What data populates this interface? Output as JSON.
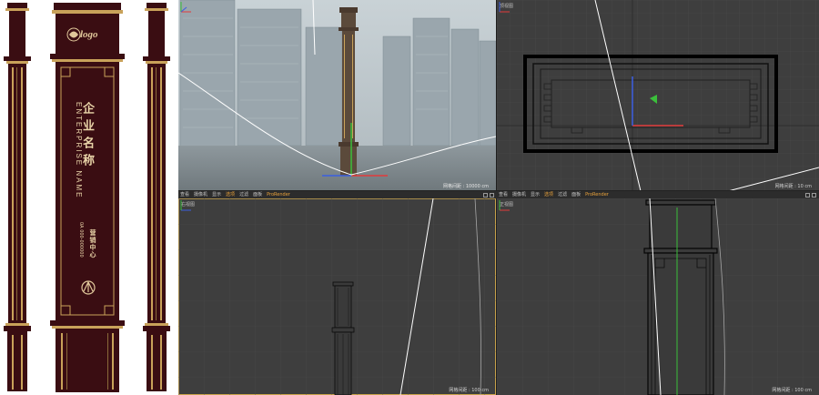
{
  "elevation": {
    "logo_text": "logo",
    "title_cn": "企业名称",
    "title_en": "ENTERPRISE NAME",
    "sales_center": "营销中心",
    "phone": "0A 000-000000"
  },
  "viewports": {
    "perspective": {
      "name": "",
      "grid_info": "网格间距 : 10000 cm"
    },
    "top": {
      "name": "顶视图",
      "grid_info": "网格间距 : 10 cm"
    },
    "right": {
      "name": "右视图",
      "grid_info": "网格间距 : 100 cm"
    },
    "front": {
      "name": "正视图",
      "grid_info": "网格间距 : 100 cm"
    }
  },
  "viewport_menu": [
    "查看",
    "摄像机",
    "显示",
    "选项",
    "过滤",
    "面板",
    "ProRender"
  ],
  "viewport_menu_highlight_index": 3,
  "colors": {
    "brand_maroon": "#3a0d12",
    "gold": "#c9a25a",
    "viewport_bg": "#3e3e3e",
    "menu_highlight": "#e9a23b",
    "axis_x": "#e23b3b",
    "axis_y": "#3bbf3b",
    "axis_z": "#3b5fe2"
  },
  "icons": [
    "logo-emblem-icon",
    "arrow-emblem-icon",
    "axis-gizmo-icon",
    "viewport-maximize-icon"
  ]
}
